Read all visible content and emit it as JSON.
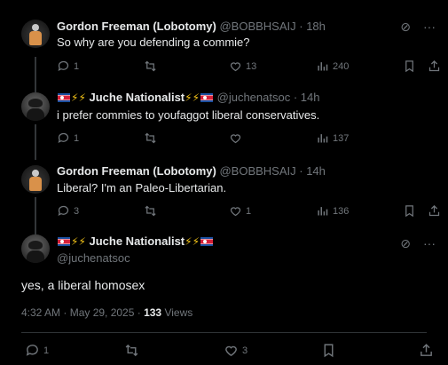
{
  "tweets": [
    {
      "name": "Gordon Freeman (Lobotomy)",
      "handle": "@BOBBHSAIJ",
      "time": "· 18h",
      "text": "So why are you defending a commie?",
      "replies": "1",
      "retweets": "",
      "likes": "13",
      "views": "240"
    },
    {
      "name": "Juche Nationalist",
      "handle": "@juchenatsoc",
      "time": "· 14h",
      "text": "i prefer commies to youfaggot liberal conservatives.",
      "replies": "1",
      "retweets": "",
      "likes": "",
      "views": "137"
    },
    {
      "name": "Gordon Freeman (Lobotomy)",
      "handle": "@BOBBHSAIJ",
      "time": "· 14h",
      "text": "Liberal? I'm an Paleo-Libertarian.",
      "replies": "3",
      "retweets": "",
      "likes": "1",
      "views": "136"
    }
  ],
  "main": {
    "name": "Juche Nationalist",
    "handle": "@juchenatsoc",
    "text": "yes, a liberal homosex",
    "timestamp": "4:32 AM · May 29, 2025 · ",
    "views_count": "133",
    "views_label": " Views",
    "replies": "1",
    "likes": "3"
  },
  "icons": {
    "grok": "grok-icon",
    "more": "more-icon",
    "reply": "reply-icon",
    "retweet": "retweet-icon",
    "like": "like-icon",
    "views": "views-icon",
    "bookmark": "bookmark-icon",
    "share": "share-icon"
  },
  "colors": {
    "background": "#000000",
    "text": "#e7e9ea",
    "muted": "#71767b",
    "bolt": "#f5c518"
  }
}
